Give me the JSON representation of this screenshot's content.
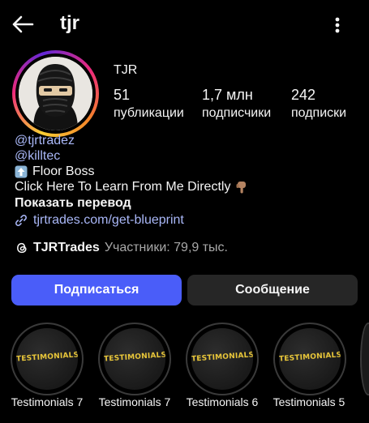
{
  "header": {
    "username": "tjr",
    "back_icon": "arrow-left-icon",
    "more_icon": "kebab-menu-icon"
  },
  "profile": {
    "display_name": "TJR",
    "stats": [
      {
        "value": "51",
        "label": "публикации"
      },
      {
        "value": "1,7 млн",
        "label": "подписчики"
      },
      {
        "value": "242",
        "label": "подписки"
      }
    ]
  },
  "bio": {
    "mentions": [
      "@tjrtradez",
      "@killtec"
    ],
    "line1": "Floor Boss",
    "line2": "Click Here To Learn From Me Directly",
    "translate": "Показать перевод",
    "link": "tjrtrades.com/get-blueprint"
  },
  "threads": {
    "name": "TJRTrades",
    "members": "Участники: 79,9 тыс."
  },
  "buttons": {
    "follow": "Подписаться",
    "message": "Сообщение"
  },
  "highlights": [
    {
      "cover_text": "TESTIMONIALS",
      "label": "Testimonials 7"
    },
    {
      "cover_text": "TESTIMONIALS",
      "label": "Testimonials 7"
    },
    {
      "cover_text": "TESTIMONIALS",
      "label": "Testimonials 6"
    },
    {
      "cover_text": "TESTIMONIALS",
      "label": "Testimonials 5"
    }
  ],
  "colors": {
    "background": "#000000",
    "accent": "#4a5df9",
    "link": "#a9b7f7",
    "highlight_text": "#e8c63a"
  }
}
